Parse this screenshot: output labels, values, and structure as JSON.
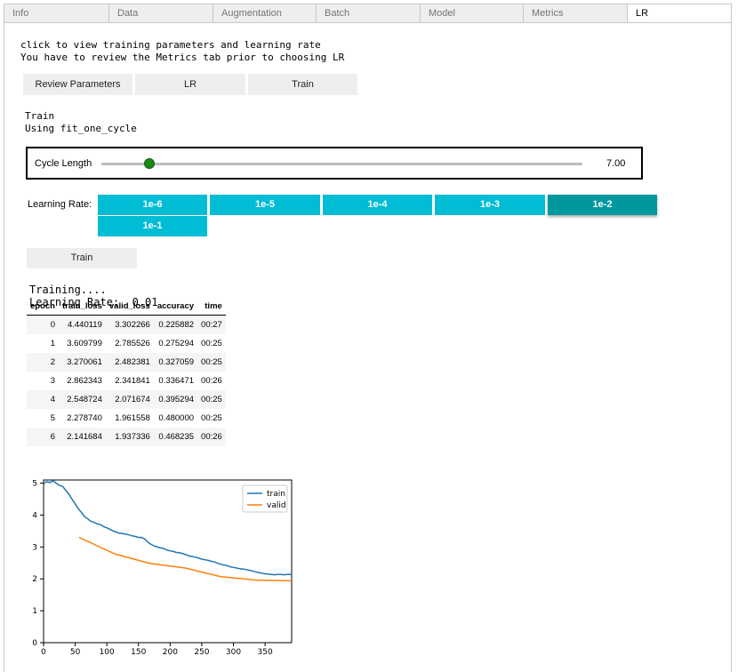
{
  "tabs": [
    "Info",
    "Data",
    "Augmentation",
    "Batch",
    "Model",
    "Metrics",
    "LR"
  ],
  "active_tab": "LR",
  "intro": {
    "line1": "click to view training parameters and learning rate",
    "line2": "You have to review the Metrics tab prior to choosing LR"
  },
  "top_buttons": {
    "review": "Review Parameters",
    "lr": "LR",
    "train": "Train"
  },
  "train_info": {
    "line1": "Train",
    "line2": "Using fit_one_cycle"
  },
  "cycle": {
    "label": "Cycle Length",
    "value": "7.00",
    "fraction": 0.1
  },
  "learning_rate": {
    "label": "Learning Rate:",
    "options": [
      "1e-6",
      "1e-5",
      "1e-4",
      "1e-3",
      "1e-2",
      "1e-1"
    ],
    "selected": "1e-2"
  },
  "train_button": "Train",
  "status": {
    "line1": "Training....",
    "line2": "Learning Rate:  0.01"
  },
  "results_table": {
    "headers": [
      "epoch",
      "train_loss",
      "valid_loss",
      "accuracy",
      "time"
    ],
    "rows": [
      [
        "0",
        "4.440119",
        "3.302266",
        "0.225882",
        "00:27"
      ],
      [
        "1",
        "3.609799",
        "2.785526",
        "0.275294",
        "00:25"
      ],
      [
        "2",
        "3.270061",
        "2.482381",
        "0.327059",
        "00:25"
      ],
      [
        "3",
        "2.862343",
        "2.341841",
        "0.336471",
        "00:26"
      ],
      [
        "4",
        "2.548724",
        "2.071674",
        "0.395294",
        "00:25"
      ],
      [
        "5",
        "2.278740",
        "1.961558",
        "0.480000",
        "00:25"
      ],
      [
        "6",
        "2.141684",
        "1.937336",
        "0.468235",
        "00:26"
      ]
    ]
  },
  "chart_data": {
    "type": "line",
    "xlim": [
      0,
      392
    ],
    "ylim": [
      0,
      5.1
    ],
    "xticks": [
      0,
      50,
      100,
      150,
      200,
      250,
      300,
      350
    ],
    "yticks": [
      0,
      1,
      2,
      3,
      4,
      5
    ],
    "legend_position": "top-right",
    "grid": false,
    "series": [
      {
        "name": "train",
        "color": "#1f77b4",
        "points": [
          [
            0,
            4.98
          ],
          [
            5,
            5.05
          ],
          [
            10,
            5.02
          ],
          [
            15,
            5.08
          ],
          [
            20,
            5.0
          ],
          [
            25,
            4.93
          ],
          [
            30,
            4.9
          ],
          [
            35,
            4.78
          ],
          [
            40,
            4.65
          ],
          [
            45,
            4.5
          ],
          [
            50,
            4.35
          ],
          [
            55,
            4.2
          ],
          [
            60,
            4.08
          ],
          [
            65,
            3.95
          ],
          [
            70,
            3.88
          ],
          [
            75,
            3.8
          ],
          [
            80,
            3.77
          ],
          [
            85,
            3.72
          ],
          [
            90,
            3.7
          ],
          [
            95,
            3.64
          ],
          [
            100,
            3.6
          ],
          [
            105,
            3.55
          ],
          [
            110,
            3.5
          ],
          [
            115,
            3.47
          ],
          [
            120,
            3.43
          ],
          [
            125,
            3.42
          ],
          [
            130,
            3.4
          ],
          [
            135,
            3.38
          ],
          [
            140,
            3.35
          ],
          [
            145,
            3.33
          ],
          [
            150,
            3.3
          ],
          [
            155,
            3.3
          ],
          [
            160,
            3.25
          ],
          [
            165,
            3.15
          ],
          [
            170,
            3.08
          ],
          [
            175,
            3.03
          ],
          [
            180,
            3.0
          ],
          [
            185,
            2.97
          ],
          [
            190,
            2.95
          ],
          [
            195,
            2.9
          ],
          [
            200,
            2.88
          ],
          [
            205,
            2.86
          ],
          [
            210,
            2.83
          ],
          [
            215,
            2.82
          ],
          [
            220,
            2.79
          ],
          [
            225,
            2.76
          ],
          [
            230,
            2.72
          ],
          [
            235,
            2.7
          ],
          [
            240,
            2.68
          ],
          [
            245,
            2.65
          ],
          [
            250,
            2.62
          ],
          [
            255,
            2.6
          ],
          [
            260,
            2.58
          ],
          [
            265,
            2.55
          ],
          [
            270,
            2.53
          ],
          [
            275,
            2.49
          ],
          [
            280,
            2.46
          ],
          [
            285,
            2.43
          ],
          [
            290,
            2.42
          ],
          [
            295,
            2.38
          ],
          [
            300,
            2.36
          ],
          [
            305,
            2.34
          ],
          [
            310,
            2.32
          ],
          [
            315,
            2.31
          ],
          [
            320,
            2.29
          ],
          [
            325,
            2.27
          ],
          [
            330,
            2.25
          ],
          [
            335,
            2.22
          ],
          [
            340,
            2.2
          ],
          [
            345,
            2.18
          ],
          [
            350,
            2.16
          ],
          [
            355,
            2.15
          ],
          [
            360,
            2.14
          ],
          [
            365,
            2.13
          ],
          [
            370,
            2.14
          ],
          [
            375,
            2.14
          ],
          [
            380,
            2.13
          ],
          [
            385,
            2.14
          ],
          [
            392,
            2.14
          ]
        ]
      },
      {
        "name": "valid",
        "color": "#ff7f0e",
        "points": [
          [
            56,
            3.302266
          ],
          [
            112,
            2.785526
          ],
          [
            168,
            2.482381
          ],
          [
            224,
            2.341841
          ],
          [
            280,
            2.071674
          ],
          [
            336,
            1.961558
          ],
          [
            392,
            1.937336
          ]
        ]
      }
    ]
  }
}
